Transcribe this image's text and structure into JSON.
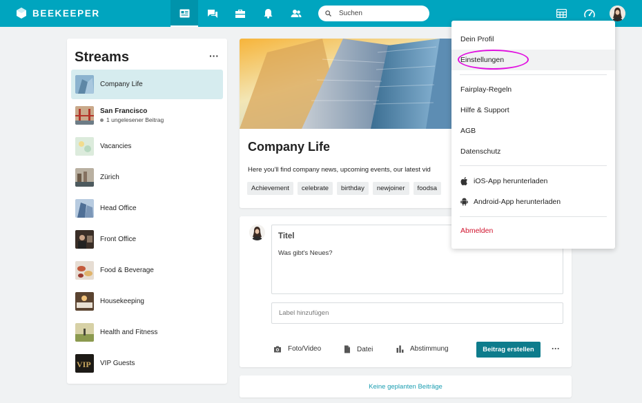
{
  "app": {
    "name": "BEEKEEPER"
  },
  "header": {
    "search_placeholder": "Suchen",
    "nav_icons": [
      "news-feed-icon",
      "chat-icon",
      "tools-icon",
      "notifications-icon",
      "people-icon"
    ],
    "right_icons": [
      "apps-grid-icon",
      "dashboard-icon",
      "profile-avatar"
    ]
  },
  "streams": {
    "title": "Streams",
    "more": "···",
    "items": [
      {
        "label": "Company Life",
        "active": true
      },
      {
        "label": "San Francisco",
        "sub": "1 ungelesener Beitrag",
        "bold": true
      },
      {
        "label": "Vacancies"
      },
      {
        "label": "Zürich"
      },
      {
        "label": "Head Office"
      },
      {
        "label": "Front Office"
      },
      {
        "label": "Food & Beverage"
      },
      {
        "label": "Housekeeping"
      },
      {
        "label": "Health and Fitness"
      },
      {
        "label": "VIP Guests"
      }
    ]
  },
  "stream_header": {
    "title": "Company Life",
    "description": "Here you'll find company news, upcoming events, our latest vid",
    "tags": [
      "Achievement",
      "celebrate",
      "birthday",
      "newjoiner",
      "foodsa"
    ]
  },
  "composer": {
    "title_placeholder": "Titel",
    "body_placeholder": "Was gibt's Neues?",
    "label_placeholder": "Label hinzufügen",
    "photo_video": "Foto/Video",
    "file": "Datei",
    "poll": "Abstimmung",
    "publish": "Beitrag erstellen",
    "more": "···"
  },
  "scheduled": {
    "label": "Keine geplanten Beiträge"
  },
  "menu": {
    "profile": "Dein Profil",
    "settings": "Einstellungen",
    "fairplay": "Fairplay-Regeln",
    "help": "Hilfe & Support",
    "terms": "AGB",
    "privacy": "Datenschutz",
    "ios": "iOS-App herunterladen",
    "android": "Android-App herunterladen",
    "logout": "Abmelden"
  },
  "colors": {
    "brand": "#00a5bf",
    "primary_button": "#0e7c8c",
    "danger": "#d0112b",
    "annotation": "#e10fe0"
  }
}
